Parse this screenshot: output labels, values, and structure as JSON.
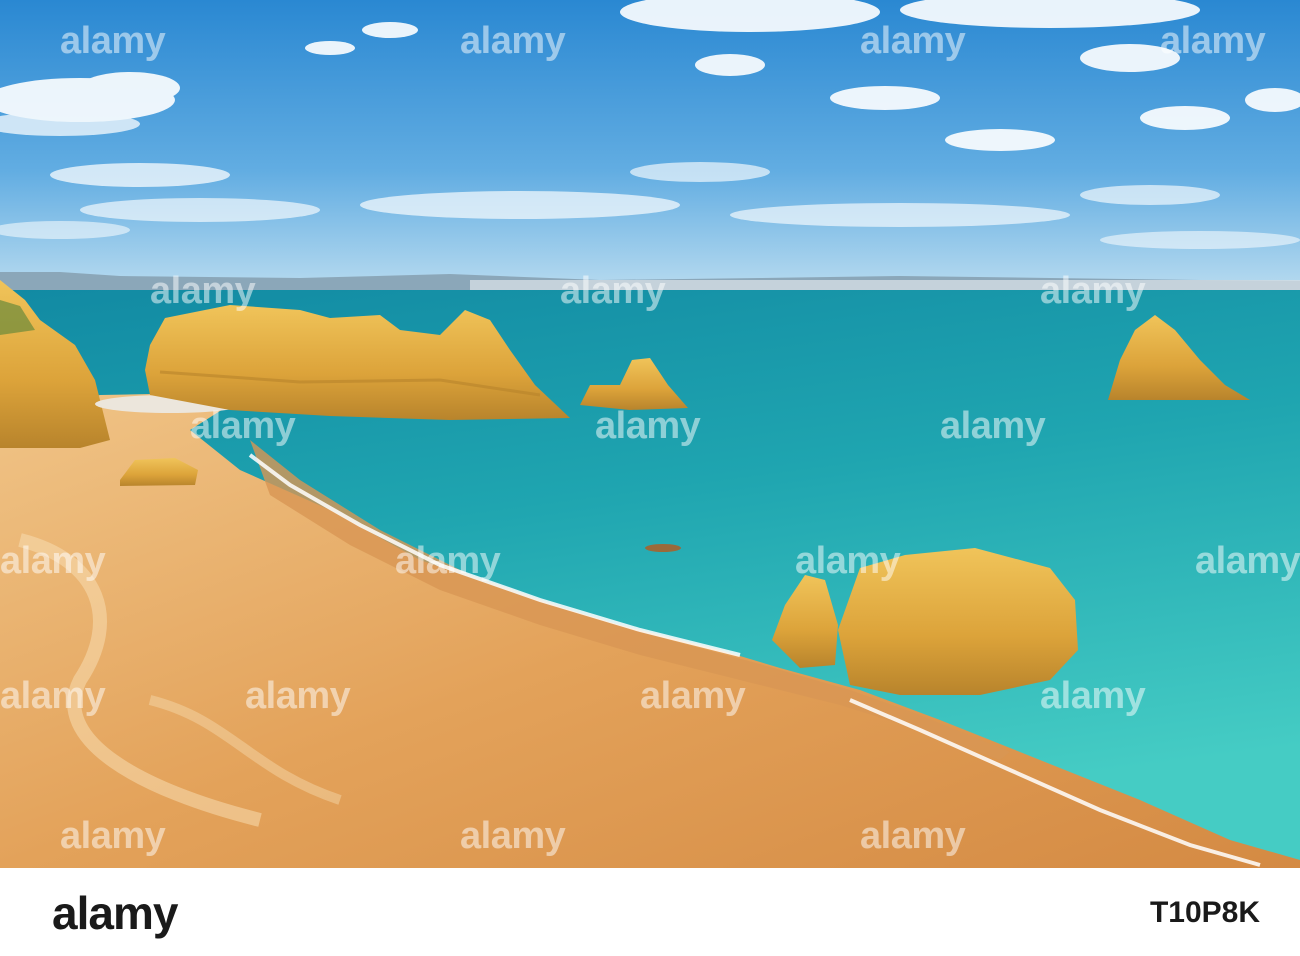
{
  "image": {
    "scene": "sandy-beach-with-sea-stacks-and-distant-coastline",
    "colors": {
      "sky_top": "#2d8fd6",
      "sky_bottom": "#a9d3ee",
      "sea_deep": "#138fa6",
      "sea_shallow": "#3fc8c4",
      "sand": "#e4a45a",
      "rock": "#e2b03f",
      "rock_shadow": "#b6852a"
    }
  },
  "watermark": {
    "text": "alamy"
  },
  "footer": {
    "brand": "alamy",
    "image_code": "T10P8K"
  }
}
